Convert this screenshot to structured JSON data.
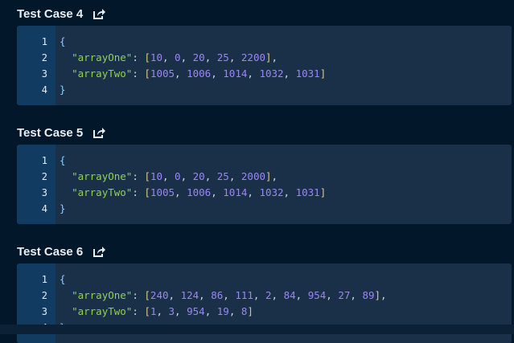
{
  "test_cases": [
    {
      "title": "Test Case 4",
      "key_one": "arrayOne",
      "array_one": [
        10,
        0,
        20,
        25,
        2200
      ],
      "key_two": "arrayTwo",
      "array_two": [
        1005,
        1006,
        1014,
        1032,
        1031
      ]
    },
    {
      "title": "Test Case 5",
      "key_one": "arrayOne",
      "array_one": [
        10,
        0,
        20,
        25,
        2000
      ],
      "key_two": "arrayTwo",
      "array_two": [
        1005,
        1006,
        1014,
        1032,
        1031
      ]
    },
    {
      "title": "Test Case 6",
      "key_one": "arrayOne",
      "array_one": [
        240,
        124,
        86,
        111,
        2,
        84,
        954,
        27,
        89
      ],
      "key_two": "arrayTwo",
      "array_two": [
        1,
        3,
        954,
        19,
        8
      ]
    }
  ],
  "line_numbers": [
    "1",
    "2",
    "3",
    "4"
  ],
  "icons": {
    "share": "share-icon"
  },
  "colors": {
    "background": "#03172a",
    "card": "#1a3049",
    "gutter": "#123b62",
    "string": "#8fd14f",
    "number": "#9a86f5",
    "brace": "#7fd3ff"
  }
}
